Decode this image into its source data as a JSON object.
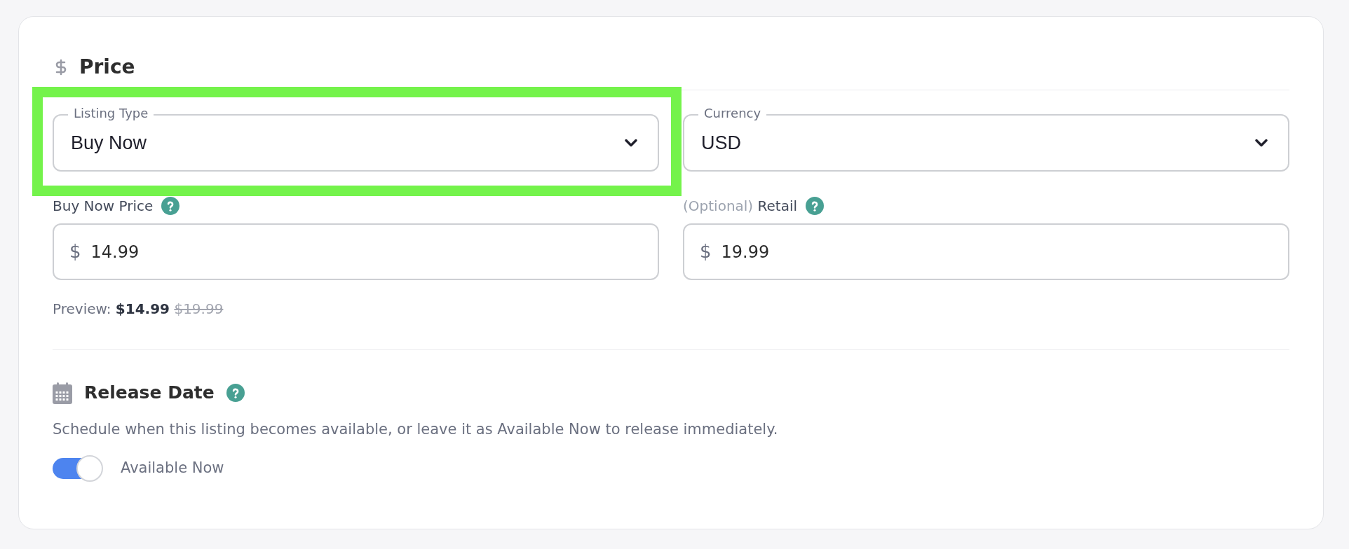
{
  "section": {
    "title": "Price"
  },
  "fields": [
    {
      "kind": "select",
      "label": "Listing Type",
      "value": "Buy Now",
      "highlighted": true
    },
    {
      "kind": "select",
      "label": "Currency",
      "value": "USD",
      "highlighted": false
    },
    {
      "kind": "price",
      "label": "Buy Now Price",
      "help": true,
      "prefix": "$",
      "value": "14.99"
    },
    {
      "kind": "price",
      "note": "(Optional)",
      "label": "Retail",
      "help": true,
      "prefix": "$",
      "value": "19.99"
    }
  ],
  "preview": {
    "label": "Preview:",
    "price": "$14.99",
    "retail": "$19.99"
  },
  "release_date": {
    "title": "Release Date",
    "help": true,
    "description": "Schedule when this listing becomes available, or leave it as Available Now to release immediately.",
    "toggle": {
      "label": "Available Now",
      "on": true
    }
  }
}
